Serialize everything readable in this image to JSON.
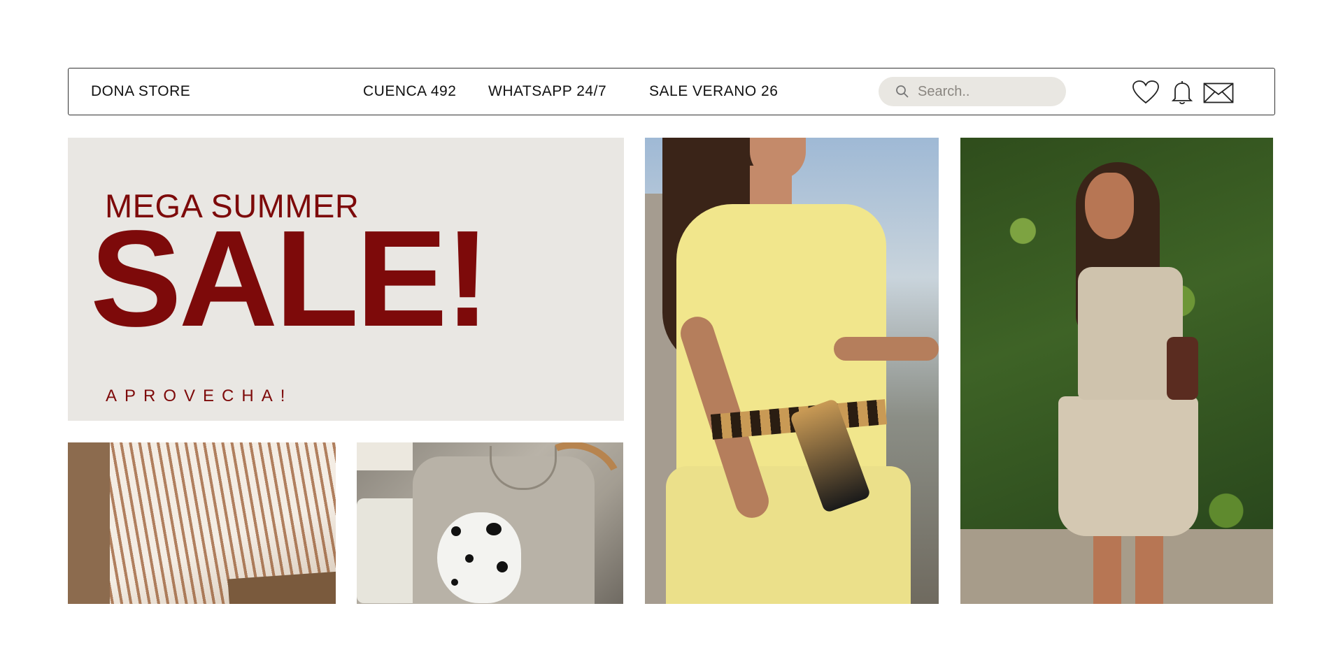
{
  "header": {
    "brand": "DONA STORE",
    "nav": [
      {
        "label": "CUENCA 492"
      },
      {
        "label": "WHATSAPP 24/7"
      },
      {
        "label": "SALE VERANO 26"
      }
    ],
    "search": {
      "placeholder": "Search..",
      "value": ""
    },
    "icons": [
      "heart-icon",
      "bell-icon",
      "mail-icon"
    ]
  },
  "promo": {
    "line1": "MEGA SUMMER",
    "line2": "SALE!",
    "line3": "APROVECHA!",
    "color": "#7d0a0a",
    "background": "#e9e7e3"
  },
  "photos": [
    {
      "id": "striped-knit-fabric"
    },
    {
      "id": "dalmatian-tee"
    },
    {
      "id": "yellow-dress-model"
    },
    {
      "id": "beige-set-model"
    }
  ]
}
